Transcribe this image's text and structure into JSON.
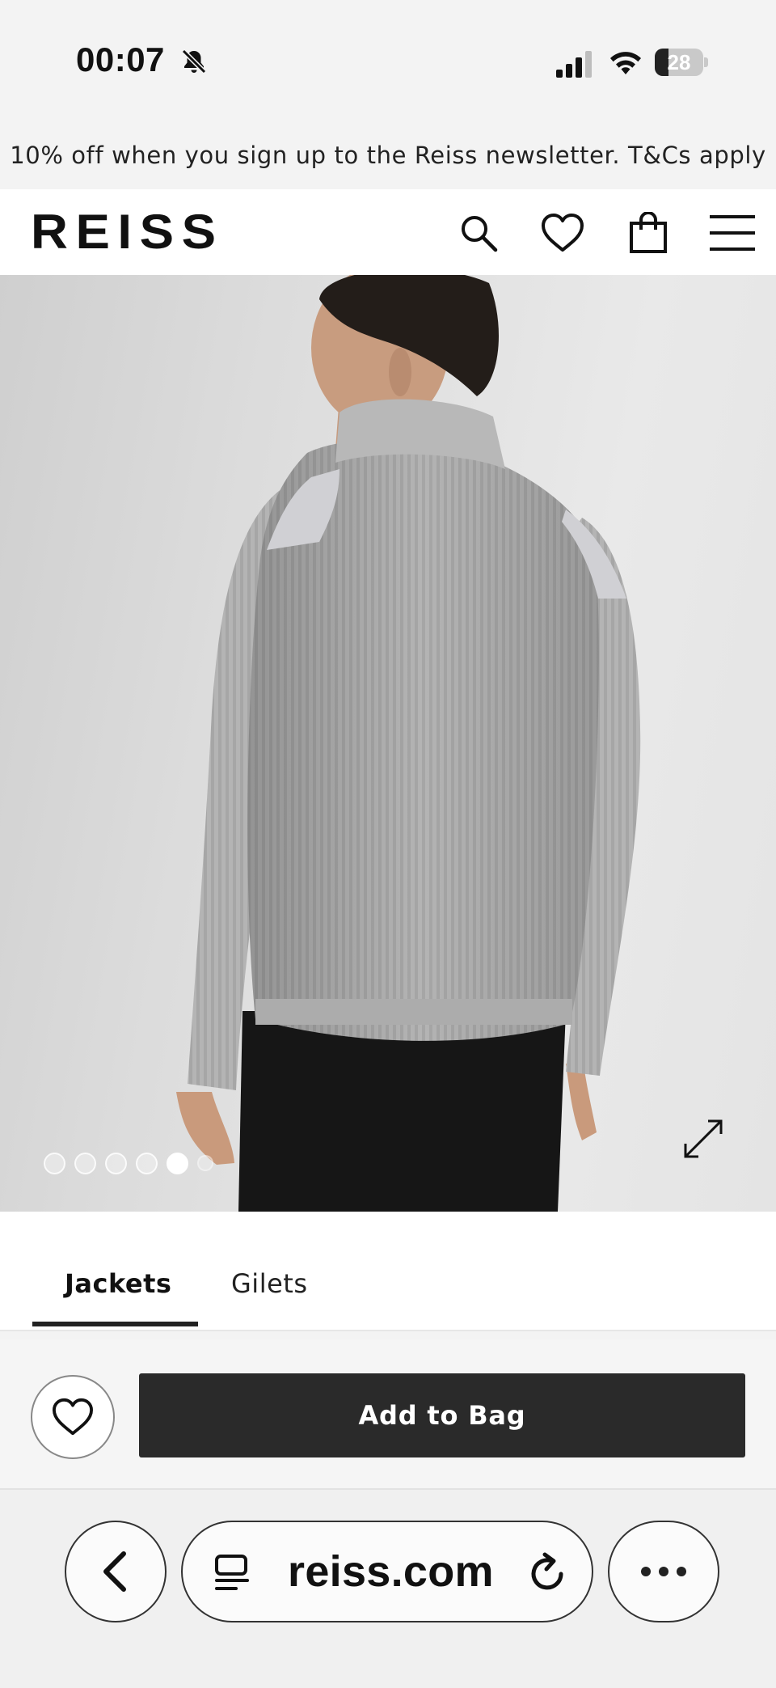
{
  "status_bar": {
    "time": "00:07",
    "battery_level": "28",
    "battery_fraction": 0.28,
    "icons": [
      "bell-slash-icon",
      "cellular-signal-icon",
      "wifi-icon",
      "battery-icon"
    ]
  },
  "promo": {
    "text": "10% off when you sign up to the Reiss newsletter. T&Cs apply"
  },
  "header": {
    "logo": "REISS",
    "icons": [
      "search-icon",
      "heart-icon",
      "bag-icon",
      "menu-icon"
    ]
  },
  "gallery": {
    "image_subject": "model-back-view-grey-knit-jacket",
    "slide_count": 6,
    "active_slide": 5,
    "expand_icon": "expand-icon"
  },
  "tabs": [
    {
      "label": "Jackets",
      "active": true
    },
    {
      "label": "Gilets",
      "active": false
    }
  ],
  "actions": {
    "wishlist_icon": "heart-icon",
    "add_to_bag": "Add to Bag"
  },
  "browser": {
    "domain": "reiss.com",
    "icons": [
      "back-chevron-icon",
      "reader-icon",
      "reload-icon",
      "more-icon"
    ]
  },
  "colors": {
    "button_dark": "#2a2a2a",
    "page_bg": "#f3f3f3"
  }
}
